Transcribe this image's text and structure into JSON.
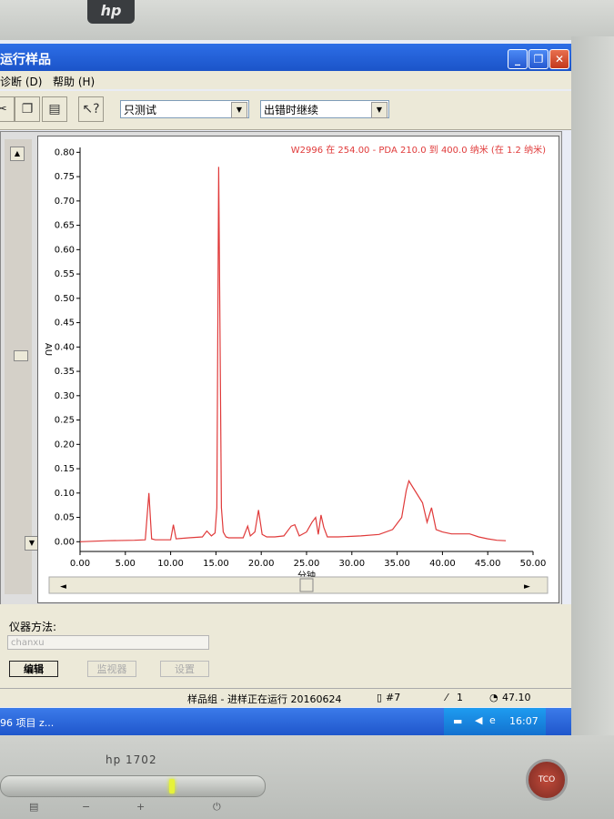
{
  "window": {
    "title": "运行样品"
  },
  "menu": {
    "items": [
      "诊断 (D)",
      "帮助 (H)"
    ]
  },
  "toolbar": {
    "icons": [
      "copy-icon",
      "clipboard-icon",
      "help-icon"
    ],
    "mode_select": "只测试",
    "error_select": "出错时继续"
  },
  "chart_data": {
    "type": "line",
    "title": "W2996 在 254.00 - PDA 210.0 到 400.0 纳米 (在 1.2 纳米)",
    "xlabel": "分钟",
    "ylabel": "AU",
    "xlim": [
      0,
      50
    ],
    "ylim": [
      -0.02,
      0.81
    ],
    "x_ticks": [
      "0.00",
      "5.00",
      "10.00",
      "15.00",
      "20.00",
      "25.00",
      "30.00",
      "35.00",
      "40.00",
      "45.00",
      "50.00"
    ],
    "y_ticks": [
      "0.00",
      "0.05",
      "0.10",
      "0.15",
      "0.20",
      "0.25",
      "0.30",
      "0.35",
      "0.40",
      "0.45",
      "0.50",
      "0.55",
      "0.60",
      "0.65",
      "0.70",
      "0.75",
      "0.80"
    ],
    "color": "#e03a3a",
    "series": [
      {
        "x": [
          0.0,
          3.0,
          6.0,
          7.2,
          7.6,
          7.9,
          8.3,
          10.0,
          10.3,
          10.6,
          12.0,
          13.5,
          14.0,
          14.5,
          14.9,
          15.1,
          15.3,
          15.6,
          15.8,
          16.1,
          16.4,
          17.0,
          18.0,
          18.5,
          18.8,
          19.3,
          19.7,
          20.1,
          20.6,
          21.5,
          22.5,
          23.3,
          23.7,
          24.2,
          25.0,
          25.6,
          26.0,
          26.3,
          26.6,
          26.9,
          27.3,
          28.5,
          31.0,
          33.0,
          34.5,
          35.5,
          36.0,
          36.3,
          36.8,
          37.3,
          37.8,
          38.3,
          38.8,
          39.3,
          40.0,
          41.0,
          43.0,
          44.0,
          45.0,
          46.0,
          47.0
        ],
        "y": [
          0.0,
          0.002,
          0.003,
          0.004,
          0.1,
          0.006,
          0.004,
          0.004,
          0.035,
          0.006,
          0.008,
          0.01,
          0.022,
          0.012,
          0.018,
          0.07,
          0.77,
          0.07,
          0.02,
          0.01,
          0.008,
          0.008,
          0.008,
          0.032,
          0.012,
          0.02,
          0.065,
          0.015,
          0.01,
          0.01,
          0.012,
          0.032,
          0.035,
          0.012,
          0.02,
          0.04,
          0.05,
          0.015,
          0.055,
          0.03,
          0.01,
          0.01,
          0.012,
          0.015,
          0.025,
          0.05,
          0.105,
          0.125,
          0.11,
          0.095,
          0.08,
          0.04,
          0.07,
          0.025,
          0.02,
          0.016,
          0.016,
          0.01,
          0.006,
          0.003,
          0.002
        ]
      }
    ]
  },
  "method": {
    "label": "仪器方法:",
    "value": "chanxu",
    "buttons": [
      "编辑",
      "监视器",
      "设置"
    ]
  },
  "status": {
    "sample_set": "样品组 - 进样正在运行 20160624",
    "vial": "#7",
    "injection": "1",
    "time": "47.10"
  },
  "taskbar": {
    "item": "96 项目 z...",
    "clock": "16:07"
  },
  "monitor": {
    "model": "hp 1702"
  }
}
